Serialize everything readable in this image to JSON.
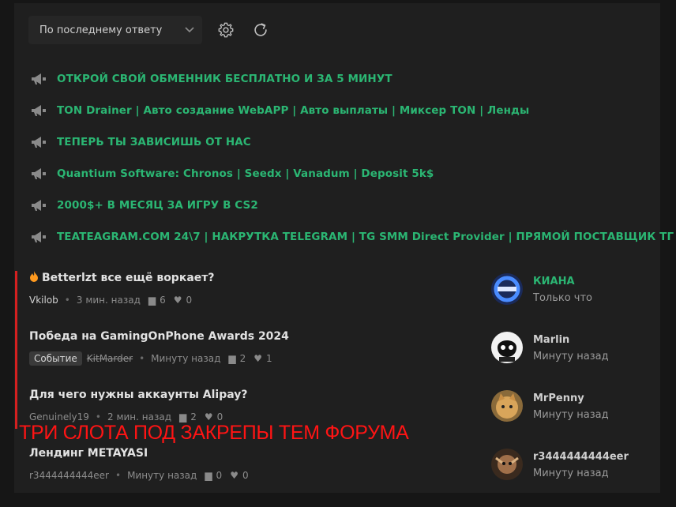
{
  "toolbar": {
    "sort_value": "По последнему ответу",
    "settings_icon": "gear-icon",
    "refresh_icon": "refresh-icon"
  },
  "announcements": [
    {
      "icon": "megaphone-icon",
      "text": "ОТКРОЙ СВОЙ ОБМЕННИК БЕСПЛАТНО И ЗА 5 МИНУТ"
    },
    {
      "icon": "megaphone-icon",
      "text": "TON Drainer | Авто создание WebAPP | Авто выплаты | Миксер TON | Ленды"
    },
    {
      "icon": "megaphone-icon",
      "text": "ТЕПЕРЬ ТЫ ЗАВИСИШЬ ОТ НАС"
    },
    {
      "icon": "megaphone-icon",
      "text": "Quantium Software: Chronos | Seedx | Vanadum | Deposit 5k$"
    },
    {
      "icon": "megaphone-icon",
      "text": "2000$+ В МЕСЯЦ ЗА ИГРУ В CS2"
    },
    {
      "icon": "megaphone-icon",
      "text": "TEATEAGRAM.COM 24\\7 | НАКРУТКА TELEGRAM | TG SMM Direct Provider | ПРЯМОЙ ПОСТАВЩИК ТГ"
    }
  ],
  "topics": [
    {
      "title": "Betterlzt все ещё воркает?",
      "author": "Vkilob",
      "time": "3 мин. назад",
      "replies": "6",
      "likes": "0"
    },
    {
      "title": "Победа на GamingOnPhone Awards 2024",
      "tag": "Событие",
      "author": "KitMarder",
      "time": "Минуту назад",
      "replies": "2",
      "likes": "1"
    },
    {
      "title": "Для чего нужны аккаунты Alipay?",
      "author": "Genuinely19",
      "time": "2 мин. назад",
      "replies": "2",
      "likes": "0"
    },
    {
      "title": "Лендинг METAYASI",
      "author": "r3444444444eer",
      "time": "Минуту назад",
      "replies": "0",
      "likes": "0"
    }
  ],
  "users": [
    {
      "name": "КИАНА",
      "time": "Только что",
      "color": "#2bb673"
    },
    {
      "name": "Marlin",
      "time": "Минуту назад",
      "color": "#cfcfcf"
    },
    {
      "name": "MrPenny",
      "time": "Минуту назад",
      "color": "#cfcfcf"
    },
    {
      "name": "r3444444444eer",
      "time": "Минуту назад",
      "color": "#cfcfcf"
    }
  ],
  "overlay": {
    "caption": "ТРИ СЛОТА ПОД ЗАКРЕПЫ ТЕМ ФОРУМА"
  },
  "colors": {
    "accent_green": "#2bb673",
    "highlight_red": "#d42020",
    "background": "#1f1f1f"
  }
}
